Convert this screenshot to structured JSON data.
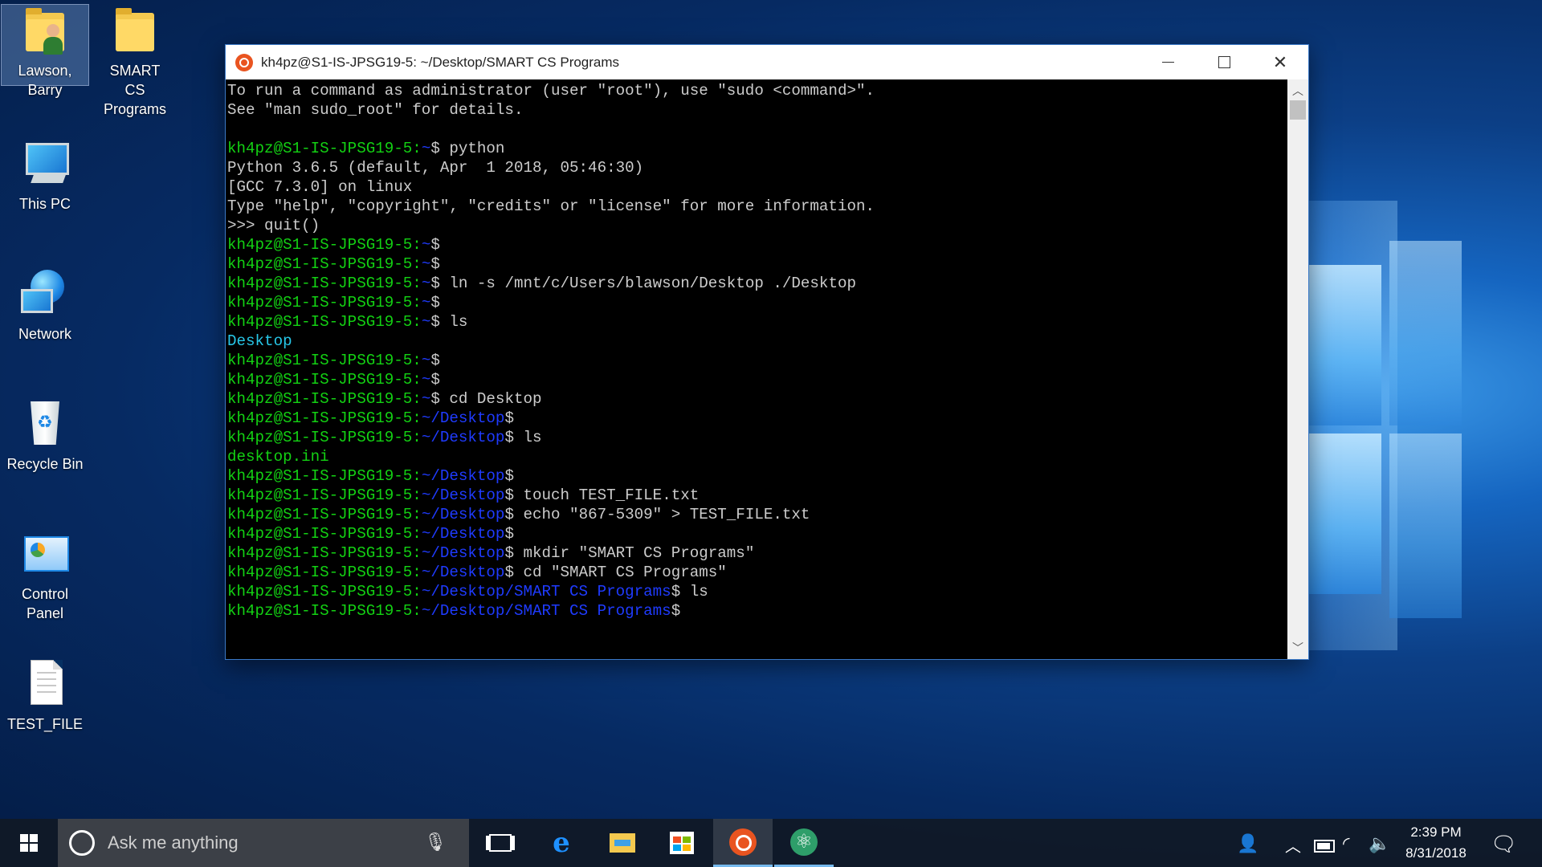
{
  "desktop": {
    "icons": [
      {
        "label": "Lawson, Barry",
        "icon": "user-folder-icon"
      },
      {
        "label": "SMART CS Programs",
        "icon": "folder-icon"
      },
      {
        "label": "This PC",
        "icon": "computer-icon"
      },
      {
        "label": "Network",
        "icon": "network-icon"
      },
      {
        "label": "Recycle Bin",
        "icon": "recycle-bin-icon"
      },
      {
        "label": "Control Panel",
        "icon": "control-panel-icon"
      },
      {
        "label": "TEST_FILE",
        "icon": "text-file-icon"
      }
    ]
  },
  "terminal": {
    "title": "kh4pz@S1-IS-JPSG19-5: ~/Desktop/SMART CS Programs",
    "controls": {
      "minimize": "minimize",
      "maximize": "maximize",
      "close": "close"
    },
    "lines": [
      [
        {
          "t": "To run a command as administrator (user \"root\"), use \"sudo <command>\".",
          "c": "w"
        }
      ],
      [
        {
          "t": "See \"man sudo_root\" for details.",
          "c": "w"
        }
      ],
      [
        {
          "t": "",
          "c": "w"
        }
      ],
      [
        {
          "t": "kh4pz@S1-IS-JPSG19-5:",
          "c": "g"
        },
        {
          "t": "~",
          "c": "b"
        },
        {
          "t": "$ python",
          "c": "w"
        }
      ],
      [
        {
          "t": "Python 3.6.5 (default, Apr  1 2018, 05:46:30)",
          "c": "w"
        }
      ],
      [
        {
          "t": "[GCC 7.3.0] on linux",
          "c": "w"
        }
      ],
      [
        {
          "t": "Type \"help\", \"copyright\", \"credits\" or \"license\" for more information.",
          "c": "w"
        }
      ],
      [
        {
          "t": ">>> quit()",
          "c": "w"
        }
      ],
      [
        {
          "t": "kh4pz@S1-IS-JPSG19-5:",
          "c": "g"
        },
        {
          "t": "~",
          "c": "b"
        },
        {
          "t": "$",
          "c": "w"
        }
      ],
      [
        {
          "t": "kh4pz@S1-IS-JPSG19-5:",
          "c": "g"
        },
        {
          "t": "~",
          "c": "b"
        },
        {
          "t": "$",
          "c": "w"
        }
      ],
      [
        {
          "t": "kh4pz@S1-IS-JPSG19-5:",
          "c": "g"
        },
        {
          "t": "~",
          "c": "b"
        },
        {
          "t": "$ ln -s /mnt/c/Users/blawson/Desktop ./Desktop",
          "c": "w"
        }
      ],
      [
        {
          "t": "kh4pz@S1-IS-JPSG19-5:",
          "c": "g"
        },
        {
          "t": "~",
          "c": "b"
        },
        {
          "t": "$",
          "c": "w"
        }
      ],
      [
        {
          "t": "kh4pz@S1-IS-JPSG19-5:",
          "c": "g"
        },
        {
          "t": "~",
          "c": "b"
        },
        {
          "t": "$ ls",
          "c": "w"
        }
      ],
      [
        {
          "t": "Desktop",
          "c": "c"
        }
      ],
      [
        {
          "t": "kh4pz@S1-IS-JPSG19-5:",
          "c": "g"
        },
        {
          "t": "~",
          "c": "b"
        },
        {
          "t": "$",
          "c": "w"
        }
      ],
      [
        {
          "t": "kh4pz@S1-IS-JPSG19-5:",
          "c": "g"
        },
        {
          "t": "~",
          "c": "b"
        },
        {
          "t": "$",
          "c": "w"
        }
      ],
      [
        {
          "t": "kh4pz@S1-IS-JPSG19-5:",
          "c": "g"
        },
        {
          "t": "~",
          "c": "b"
        },
        {
          "t": "$ cd Desktop",
          "c": "w"
        }
      ],
      [
        {
          "t": "kh4pz@S1-IS-JPSG19-5:",
          "c": "g"
        },
        {
          "t": "~/Desktop",
          "c": "b"
        },
        {
          "t": "$",
          "c": "w"
        }
      ],
      [
        {
          "t": "kh4pz@S1-IS-JPSG19-5:",
          "c": "g"
        },
        {
          "t": "~/Desktop",
          "c": "b"
        },
        {
          "t": "$ ls",
          "c": "w"
        }
      ],
      [
        {
          "t": "desktop.ini",
          "c": "g"
        }
      ],
      [
        {
          "t": "kh4pz@S1-IS-JPSG19-5:",
          "c": "g"
        },
        {
          "t": "~/Desktop",
          "c": "b"
        },
        {
          "t": "$",
          "c": "w"
        }
      ],
      [
        {
          "t": "kh4pz@S1-IS-JPSG19-5:",
          "c": "g"
        },
        {
          "t": "~/Desktop",
          "c": "b"
        },
        {
          "t": "$ touch TEST_FILE.txt",
          "c": "w"
        }
      ],
      [
        {
          "t": "kh4pz@S1-IS-JPSG19-5:",
          "c": "g"
        },
        {
          "t": "~/Desktop",
          "c": "b"
        },
        {
          "t": "$ echo \"867-5309\" > TEST_FILE.txt",
          "c": "w"
        }
      ],
      [
        {
          "t": "kh4pz@S1-IS-JPSG19-5:",
          "c": "g"
        },
        {
          "t": "~/Desktop",
          "c": "b"
        },
        {
          "t": "$",
          "c": "w"
        }
      ],
      [
        {
          "t": "kh4pz@S1-IS-JPSG19-5:",
          "c": "g"
        },
        {
          "t": "~/Desktop",
          "c": "b"
        },
        {
          "t": "$ mkdir \"SMART CS Programs\"",
          "c": "w"
        }
      ],
      [
        {
          "t": "kh4pz@S1-IS-JPSG19-5:",
          "c": "g"
        },
        {
          "t": "~/Desktop",
          "c": "b"
        },
        {
          "t": "$ cd \"SMART CS Programs\"",
          "c": "w"
        }
      ],
      [
        {
          "t": "kh4pz@S1-IS-JPSG19-5:",
          "c": "g"
        },
        {
          "t": "~/Desktop/SMART CS Programs",
          "c": "b"
        },
        {
          "t": "$ ls",
          "c": "w"
        }
      ],
      [
        {
          "t": "kh4pz@S1-IS-JPSG19-5:",
          "c": "g"
        },
        {
          "t": "~/Desktop/SMART CS Programs",
          "c": "b"
        },
        {
          "t": "$",
          "c": "w"
        }
      ]
    ]
  },
  "taskbar": {
    "search_placeholder": "Ask me anything",
    "apps": [
      "task-view-icon",
      "edge-icon",
      "file-explorer-icon",
      "store-icon",
      "ubuntu-icon",
      "atom-icon"
    ],
    "clock": {
      "time": "2:39 PM",
      "date": "8/31/2018"
    }
  }
}
